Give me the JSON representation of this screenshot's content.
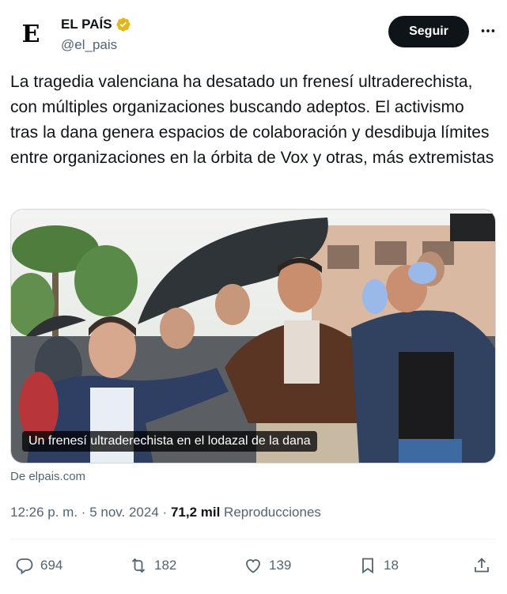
{
  "account": {
    "avatar_letter": "E",
    "display_name": "EL PAÍS",
    "handle": "@el_pais",
    "verified_color": "#E2B719"
  },
  "header": {
    "follow_label": "Seguir",
    "more_icon": "more-horizontal-icon"
  },
  "tweet": {
    "text": "La tragedia valenciana ha desatado un frenesí ultraderechista, con múltiples organizaciones buscando adeptos. El activismo tras la dana genera espacios de colaboración y desdibuja límites entre organizaciones en la órbita de Vox y otras, más extremistas"
  },
  "media": {
    "caption": "Un frenesí ultraderechista en el lodazal de la dana"
  },
  "link_source": "De elpais.com",
  "meta": {
    "time": "12:26 p. m.",
    "separator": "·",
    "date": "5 nov. 2024",
    "views_count": "71,2 mil",
    "views_label": "Reproducciones"
  },
  "actions": {
    "replies": "694",
    "reposts": "182",
    "likes": "139",
    "bookmarks": "18"
  },
  "colors": {
    "text_primary": "#0f1419",
    "text_secondary": "#536471",
    "button_bg": "#0f1419"
  }
}
